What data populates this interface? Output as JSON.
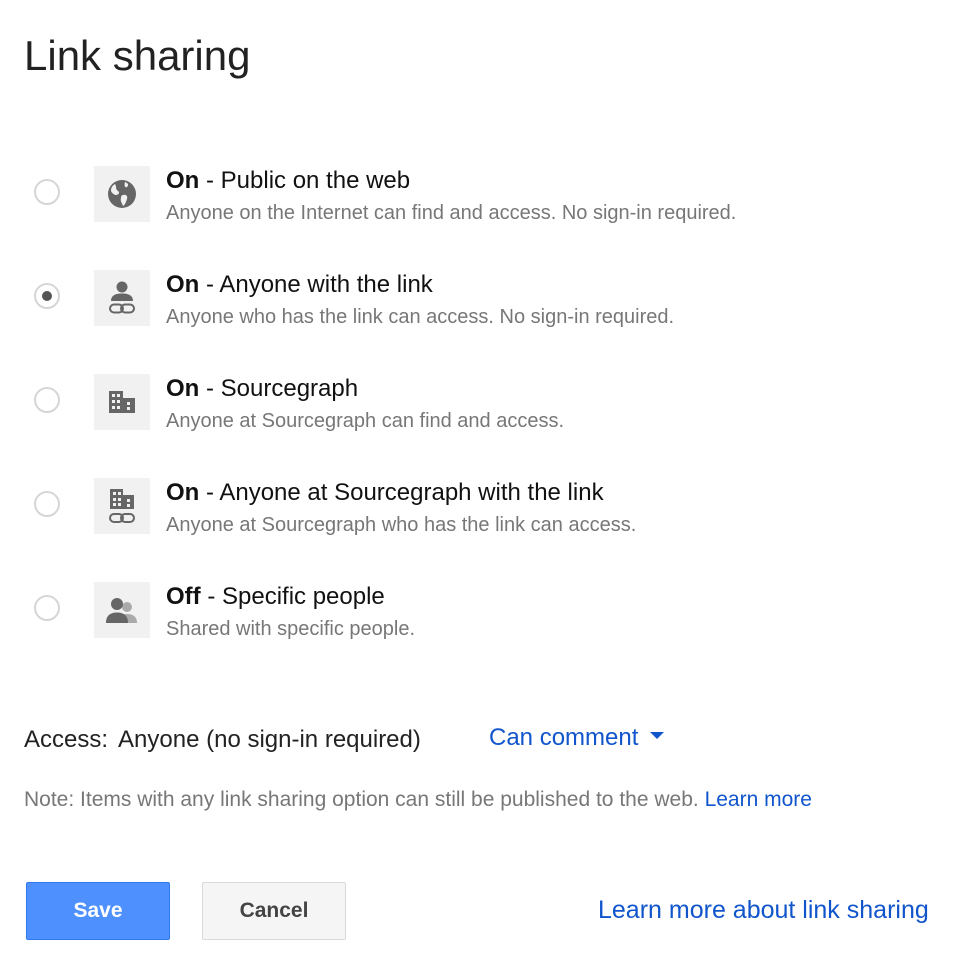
{
  "dialog": {
    "title": "Link sharing"
  },
  "options": [
    {
      "state": "On",
      "label": " - Public on the web",
      "description": "Anyone on the Internet can find and access. No sign-in required.",
      "icon": "globe-icon",
      "selected": false
    },
    {
      "state": "On",
      "label": " - Anyone with the link",
      "description": "Anyone who has the link can access. No sign-in required.",
      "icon": "person-link-icon",
      "selected": true
    },
    {
      "state": "On",
      "label": " - Sourcegraph",
      "description": "Anyone at Sourcegraph can find and access.",
      "icon": "building-icon",
      "selected": false
    },
    {
      "state": "On",
      "label": " - Anyone at Sourcegraph with the link",
      "description": "Anyone at Sourcegraph who has the link can access.",
      "icon": "building-link-icon",
      "selected": false
    },
    {
      "state": "Off",
      "label": " - Specific people",
      "description": "Shared with specific people.",
      "icon": "people-icon",
      "selected": false
    }
  ],
  "access": {
    "label": "Access:",
    "value": "Anyone (no sign-in required)",
    "permission": "Can comment"
  },
  "note": {
    "text": "Note: Items with any link sharing option can still be published to the web.",
    "link": "Learn more"
  },
  "buttons": {
    "save": "Save",
    "cancel": "Cancel"
  },
  "footer_link": "Learn more about link sharing",
  "colors": {
    "link": "#1155cc",
    "primary_button": "#4d90fe",
    "secondary_text": "#777777",
    "icon_tile": "#f1f1f1",
    "icon_fill": "#666666"
  }
}
